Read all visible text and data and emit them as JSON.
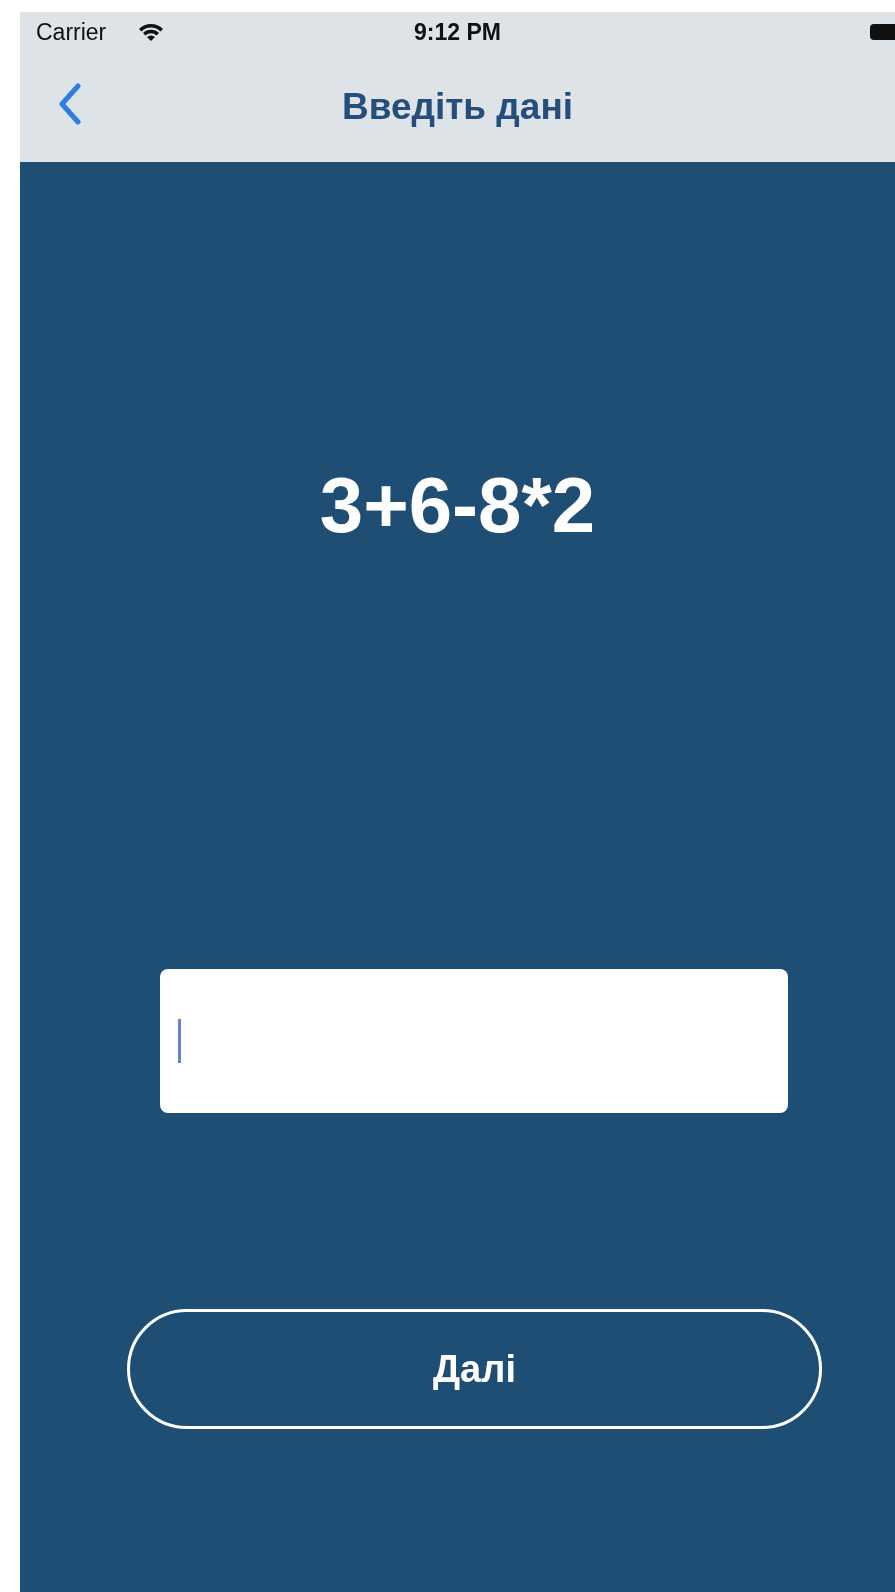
{
  "status_bar": {
    "carrier": "Carrier",
    "time": "9:12 PM"
  },
  "nav_bar": {
    "title": "Введіть дані"
  },
  "expression": "3+6-8*2",
  "answer_field": {
    "focused": true
  },
  "next_button": {
    "label": "Далі"
  }
}
